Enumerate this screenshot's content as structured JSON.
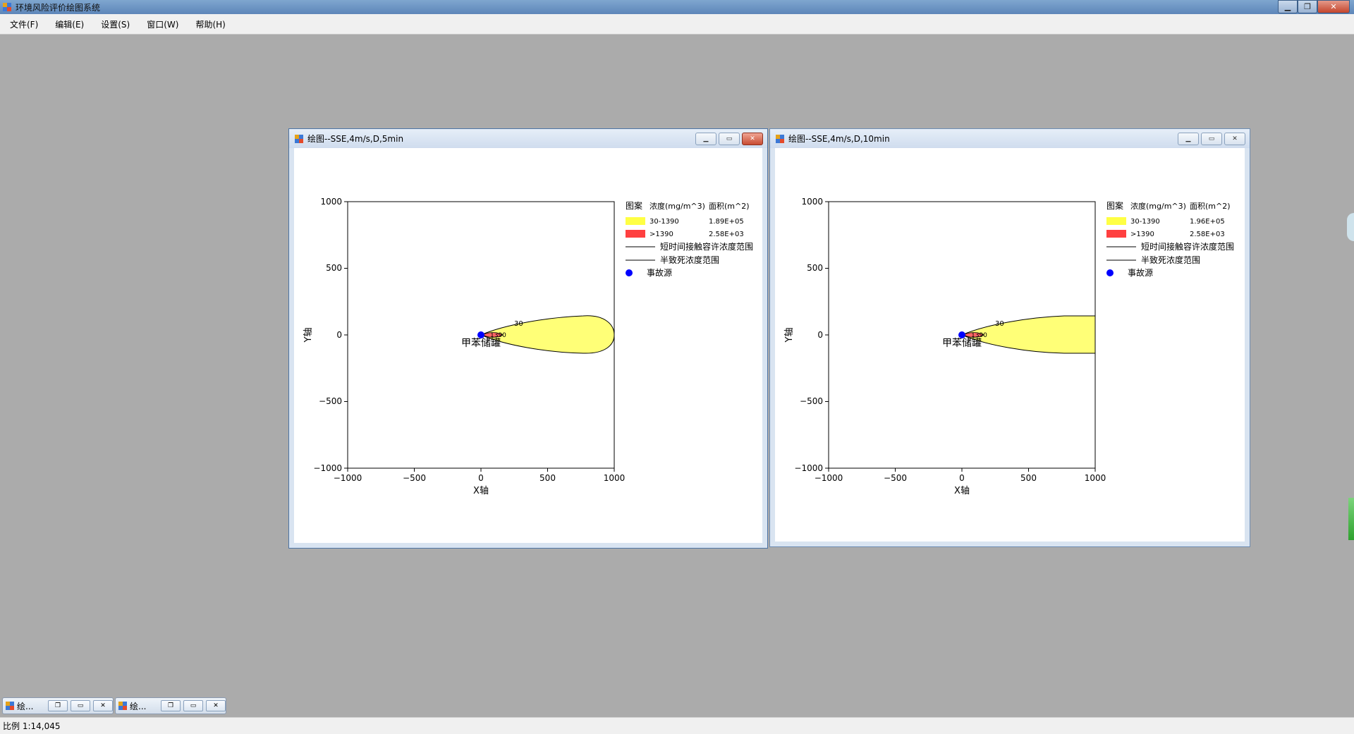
{
  "app": {
    "title": "环境风险评价绘图系统"
  },
  "menu": {
    "items": [
      "文件(F)",
      "编辑(E)",
      "设置(S)",
      "窗口(W)",
      "帮助(H)"
    ]
  },
  "windows": [
    {
      "title": "绘图--SSE,4m/s,D,5min",
      "legend": {
        "header": [
          "图案",
          "浓度(mg/m^3)",
          "面积(m^2)"
        ],
        "rows": [
          {
            "range": "30-1390",
            "area": "1.89E+05",
            "color": "#ffff44"
          },
          {
            "range": ">1390",
            "area": "2.58E+03",
            "color": "#ff4040"
          }
        ],
        "line1": "短时间接触容许浓度范围",
        "line2": "半致死浓度范围",
        "source": "事故源"
      },
      "plot": {
        "xlabel": "X轴",
        "ylabel": "Y轴",
        "xticks": [
          "−1000",
          "−500",
          "0",
          "500",
          "1000"
        ],
        "yticks": [
          "1000",
          "500",
          "0",
          "−500",
          "−1000"
        ],
        "source_label": "甲苯储罐",
        "contour_labels": [
          "30",
          "1390"
        ]
      }
    },
    {
      "title": "绘图--SSE,4m/s,D,10min",
      "legend": {
        "header": [
          "图案",
          "浓度(mg/m^3)",
          "面积(m^2)"
        ],
        "rows": [
          {
            "range": "30-1390",
            "area": "1.96E+05",
            "color": "#ffff44"
          },
          {
            "range": ">1390",
            "area": "2.58E+03",
            "color": "#ff4040"
          }
        ],
        "line1": "短时间接触容许浓度范围",
        "line2": "半致死浓度范围",
        "source": "事故源"
      },
      "plot": {
        "xlabel": "X轴",
        "ylabel": "Y轴",
        "xticks": [
          "−1000",
          "−500",
          "0",
          "500",
          "1000"
        ],
        "yticks": [
          "1000",
          "500",
          "0",
          "−500",
          "−1000"
        ],
        "source_label": "甲苯储罐",
        "contour_labels": [
          "30",
          "1390"
        ]
      }
    }
  ],
  "taskbar": [
    {
      "label": "绘..."
    },
    {
      "label": "绘..."
    }
  ],
  "status": {
    "scale": "比例 1:14,045"
  }
}
